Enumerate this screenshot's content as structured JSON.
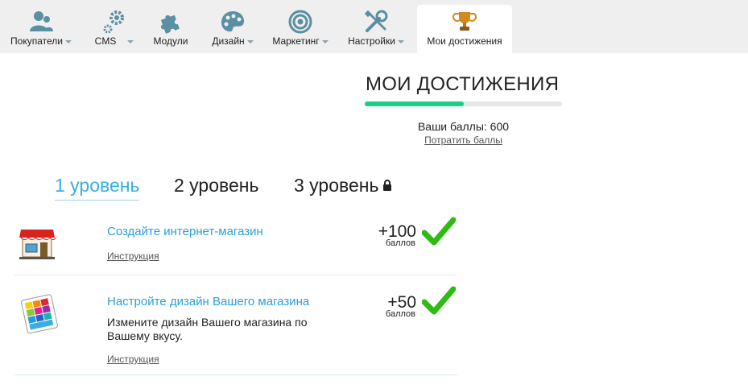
{
  "nav": {
    "items": [
      {
        "label": "Покупатели",
        "icon": "users-icon",
        "caret": true
      },
      {
        "label": "CMS",
        "icon": "gears-icon",
        "caret": true
      },
      {
        "label": "Модули",
        "icon": "puzzle-icon",
        "caret": false
      },
      {
        "label": "Дизайн",
        "icon": "palette-icon",
        "caret": true
      },
      {
        "label": "Маркетинг",
        "icon": "target-icon",
        "caret": true
      },
      {
        "label": "Настройки",
        "icon": "tools-icon",
        "caret": true
      },
      {
        "label": "Мои достижения",
        "icon": "trophy-icon",
        "caret": false,
        "active": true
      }
    ]
  },
  "header": {
    "title": "МОИ ДОСТИЖЕНИЯ",
    "progress": 0.5,
    "points_text": "Ваши баллы: 600",
    "spend_link": "Потратить баллы"
  },
  "levels": [
    {
      "label": "1 уровень",
      "active": true
    },
    {
      "label": "2 уровень",
      "active": false
    },
    {
      "label": "3 уровень",
      "active": false,
      "locked": true
    }
  ],
  "tasks": [
    {
      "title": "Создайте интернет-магазин",
      "description": "",
      "link": "Инструкция",
      "points": "+100",
      "unit": "баллов",
      "icon": "shop-icon",
      "completed": true
    },
    {
      "title": "Настройте дизайн Вашего магазина",
      "description": "Измените дизайн Вашего магазина по Вашему вкусу.",
      "link": "Инструкция",
      "points": "+50",
      "unit": "баллов",
      "icon": "color-swatch-icon",
      "completed": true
    }
  ],
  "colors": {
    "accent_blue": "#3aaee0",
    "link_blue": "#2b9fd9",
    "progress_green": "#1ccf85",
    "check_green": "#2dbb14",
    "nav_icon": "#5b8fa3"
  }
}
